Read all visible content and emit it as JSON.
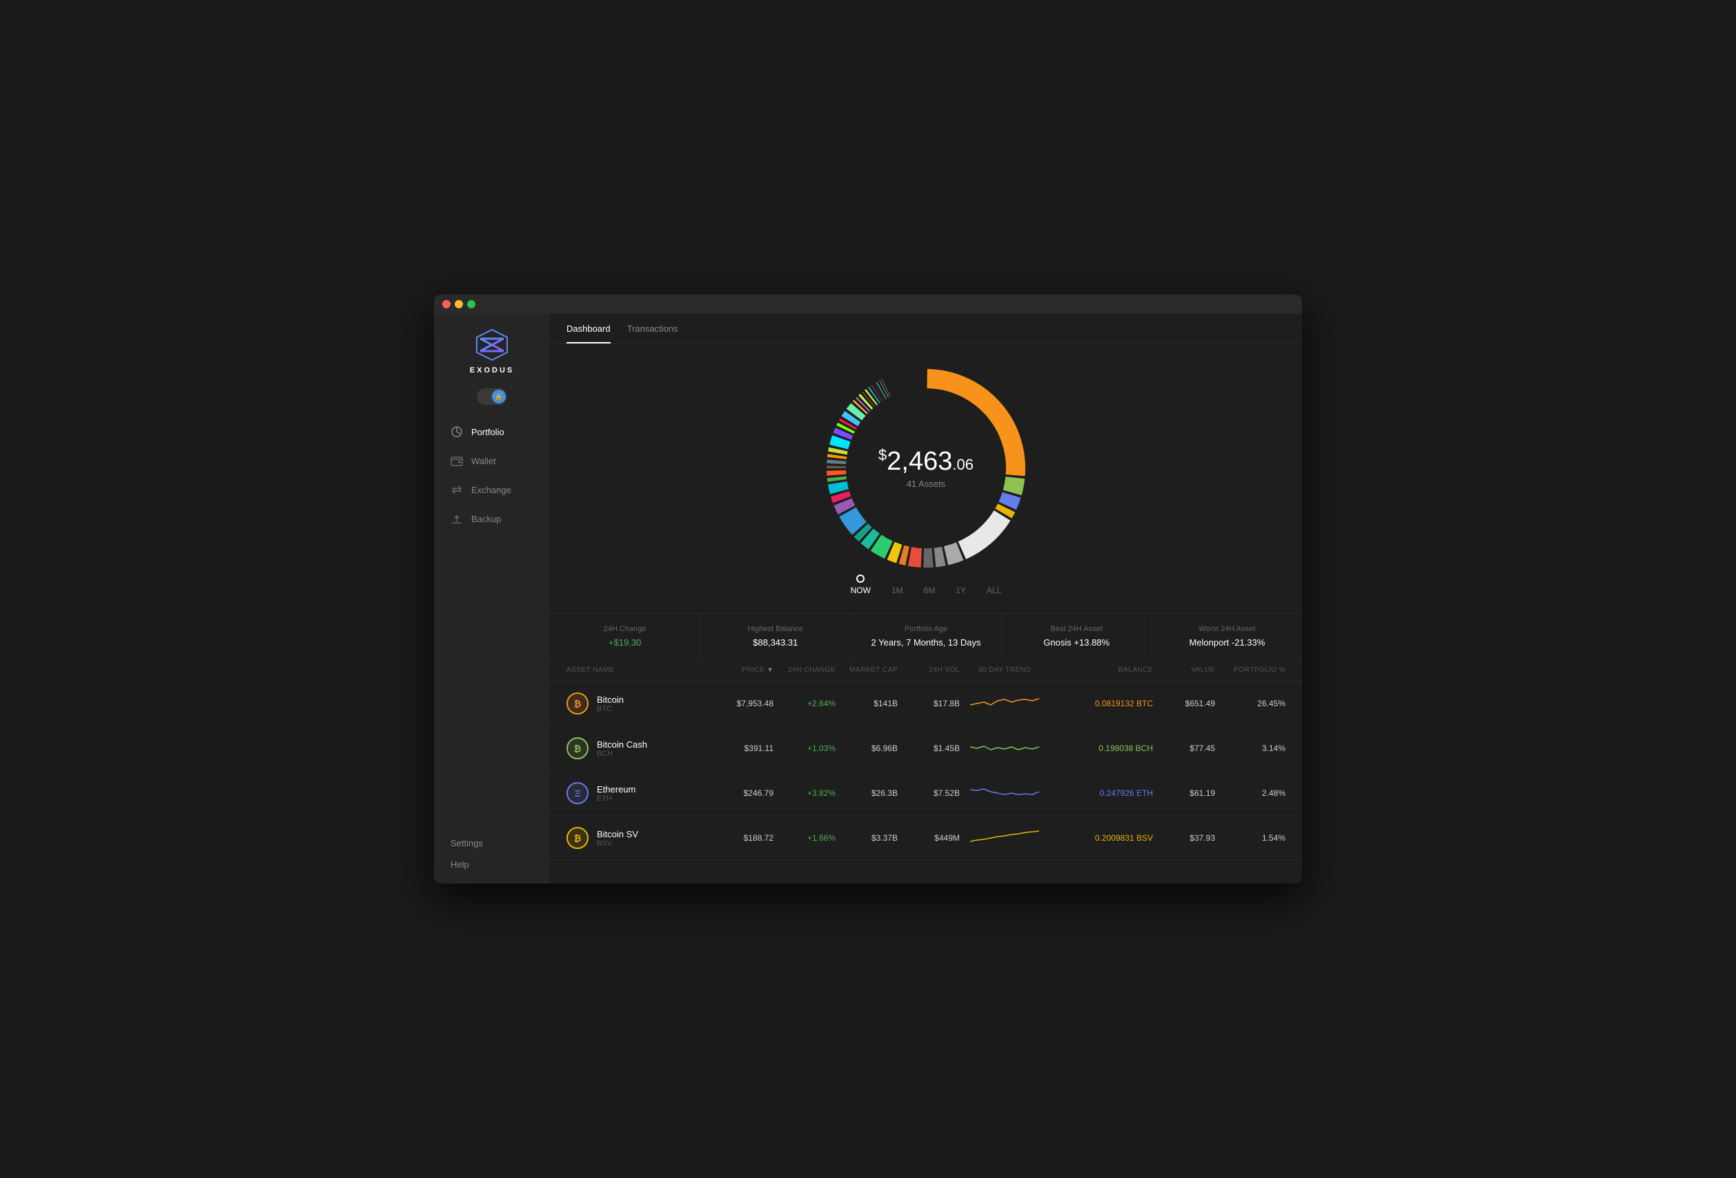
{
  "app": {
    "title": "EXODUS",
    "window_controls": [
      "close",
      "minimize",
      "maximize"
    ]
  },
  "sidebar": {
    "nav_items": [
      {
        "id": "portfolio",
        "label": "Portfolio",
        "icon": "chart-pie",
        "active": true
      },
      {
        "id": "wallet",
        "label": "Wallet",
        "icon": "wallet"
      },
      {
        "id": "exchange",
        "label": "Exchange",
        "icon": "exchange"
      },
      {
        "id": "backup",
        "label": "Backup",
        "icon": "backup"
      }
    ],
    "bottom_items": [
      {
        "id": "settings",
        "label": "Settings"
      },
      {
        "id": "help",
        "label": "Help"
      }
    ]
  },
  "tabs": [
    {
      "id": "dashboard",
      "label": "Dashboard",
      "active": true
    },
    {
      "id": "transactions",
      "label": "Transactions",
      "active": false
    }
  ],
  "portfolio": {
    "total_value": "2,463",
    "total_cents": ".06",
    "dollar_sign": "$",
    "assets_count": "41 Assets"
  },
  "time_options": [
    {
      "id": "now",
      "label": "NOW",
      "active": true
    },
    {
      "id": "1m",
      "label": "1M"
    },
    {
      "id": "6m",
      "label": "6M"
    },
    {
      "id": "1y",
      "label": "1Y"
    },
    {
      "id": "all",
      "label": "ALL"
    }
  ],
  "stats": [
    {
      "label": "24H Change",
      "value": "+$19.30",
      "positive": true
    },
    {
      "label": "Highest Balance",
      "value": "$88,343.31",
      "positive": false
    },
    {
      "label": "Portfolio Age",
      "value": "2 Years, 7 Months, 13 Days",
      "positive": false
    },
    {
      "label": "Best 24H Asset",
      "value": "Gnosis +13.88%",
      "positive": false
    },
    {
      "label": "Worst 24H Asset",
      "value": "Melonport -21.33%",
      "positive": false
    }
  ],
  "table": {
    "headers": [
      {
        "id": "asset",
        "label": "ASSET NAME"
      },
      {
        "id": "price",
        "label": "PRICE",
        "sortable": true
      },
      {
        "id": "change",
        "label": "24H CHANGE"
      },
      {
        "id": "mktcap",
        "label": "MARKET CAP"
      },
      {
        "id": "vol",
        "label": "24H VOL"
      },
      {
        "id": "trend",
        "label": "30 DAY TREND"
      },
      {
        "id": "balance",
        "label": "BALANCE"
      },
      {
        "id": "value",
        "label": "VALUE"
      },
      {
        "id": "portfolio",
        "label": "PORTFOLIO %"
      }
    ],
    "rows": [
      {
        "name": "Bitcoin",
        "ticker": "BTC",
        "icon_color": "#f7931a",
        "icon_text": "₿",
        "price": "$7,953.48",
        "change": "+2.64%",
        "change_positive": true,
        "mktcap": "$141B",
        "vol": "$17.8B",
        "balance": "0.0819132 BTC",
        "balance_color": "#f7931a",
        "value": "$651.49",
        "portfolio": "26.45%",
        "trend_color": "#f7931a"
      },
      {
        "name": "Bitcoin Cash",
        "ticker": "BCH",
        "icon_color": "#8dc351",
        "icon_text": "₿",
        "price": "$391.11",
        "change": "+1.03%",
        "change_positive": true,
        "mktcap": "$6.96B",
        "vol": "$1.45B",
        "balance": "0.198038 BCH",
        "balance_color": "#8dc351",
        "value": "$77.45",
        "portfolio": "3.14%",
        "trend_color": "#8dc351"
      },
      {
        "name": "Ethereum",
        "ticker": "ETH",
        "icon_color": "#627eea",
        "icon_text": "Ξ",
        "price": "$246.79",
        "change": "+3.82%",
        "change_positive": true,
        "mktcap": "$26.3B",
        "vol": "$7.52B",
        "balance": "0.247926 ETH",
        "balance_color": "#627eea",
        "value": "$61.19",
        "portfolio": "2.48%",
        "trend_color": "#627eea"
      },
      {
        "name": "Bitcoin SV",
        "ticker": "BSV",
        "icon_color": "#eab300",
        "icon_text": "₿",
        "price": "$188.72",
        "change": "+1.66%",
        "change_positive": true,
        "mktcap": "$3.37B",
        "vol": "$449M",
        "balance": "0.2009831 BSV",
        "balance_color": "#eab300",
        "value": "$37.93",
        "portfolio": "1.54%",
        "trend_color": "#eab300"
      }
    ]
  },
  "donut_segments": [
    {
      "color": "#f7931a",
      "pct": 26.45
    },
    {
      "color": "#8dc351",
      "pct": 3.14
    },
    {
      "color": "#627eea",
      "pct": 2.48
    },
    {
      "color": "#eab300",
      "pct": 1.54
    },
    {
      "color": "#e8e8e8",
      "pct": 10
    },
    {
      "color": "#aaaaaa",
      "pct": 3
    },
    {
      "color": "#888888",
      "pct": 2
    },
    {
      "color": "#666666",
      "pct": 2
    },
    {
      "color": "#e74c3c",
      "pct": 2.5
    },
    {
      "color": "#e67e22",
      "pct": 1.5
    },
    {
      "color": "#f1c40f",
      "pct": 2
    },
    {
      "color": "#2ecc71",
      "pct": 3
    },
    {
      "color": "#1abc9c",
      "pct": 2
    },
    {
      "color": "#16a085",
      "pct": 1.5
    },
    {
      "color": "#3498db",
      "pct": 4
    },
    {
      "color": "#9b59b6",
      "pct": 2
    },
    {
      "color": "#e91e63",
      "pct": 1.5
    },
    {
      "color": "#00bcd4",
      "pct": 2
    },
    {
      "color": "#4caf50",
      "pct": 1
    },
    {
      "color": "#ff5722",
      "pct": 1.2
    },
    {
      "color": "#795548",
      "pct": 0.8
    },
    {
      "color": "#607d8b",
      "pct": 1
    },
    {
      "color": "#ff9800",
      "pct": 0.9
    },
    {
      "color": "#cddc39",
      "pct": 1.1
    },
    {
      "color": "#00e5ff",
      "pct": 2
    },
    {
      "color": "#7c4dff",
      "pct": 1.3
    },
    {
      "color": "#76ff03",
      "pct": 0.9
    },
    {
      "color": "#ff1744",
      "pct": 0.8
    },
    {
      "color": "#40c4ff",
      "pct": 1.4
    },
    {
      "color": "#69f0ae",
      "pct": 1.6
    },
    {
      "color": "#ffab40",
      "pct": 0.7
    },
    {
      "color": "#ea80fc",
      "pct": 0.6
    },
    {
      "color": "#b2ff59",
      "pct": 0.8
    },
    {
      "color": "#ff6d00",
      "pct": 0.5
    },
    {
      "color": "#d4e157",
      "pct": 0.7
    },
    {
      "color": "#26c6da",
      "pct": 0.6
    },
    {
      "color": "#ab47bc",
      "pct": 0.5
    },
    {
      "color": "#ef5350",
      "pct": 0.4
    },
    {
      "color": "#26a69a",
      "pct": 0.6
    },
    {
      "color": "#ffa726",
      "pct": 0.5
    },
    {
      "color": "#5c6bc0",
      "pct": 0.3
    }
  ]
}
